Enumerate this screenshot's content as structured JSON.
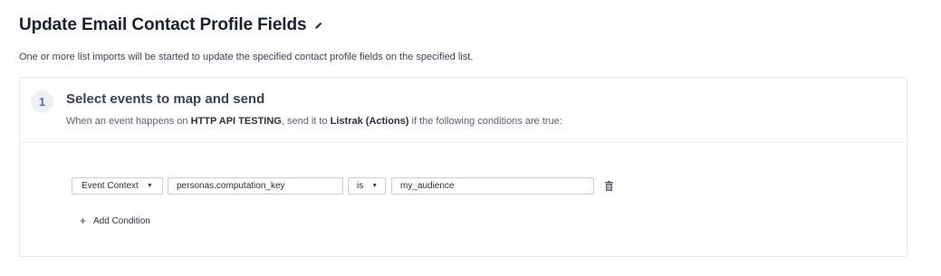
{
  "page": {
    "title": "Update Email Contact Profile Fields",
    "description": "One or more list imports will be started to update the specified contact profile fields on the specified list."
  },
  "step": {
    "number": "1",
    "title": "Select events to map and send",
    "subtitle": {
      "prefix": "When an event happens on ",
      "source": "HTTP API TESTING",
      "middle": ", send it to ",
      "destination": "Listrak (Actions)",
      "suffix": " if the following conditions are true:"
    }
  },
  "condition": {
    "field_type": "Event Context",
    "key": "personas.computation_key",
    "operator": "is",
    "value": "my_audience"
  },
  "actions": {
    "add_condition": "Add Condition"
  },
  "icons": {
    "edit": "pencil-icon",
    "delete": "trash-icon",
    "add": "plus-icon",
    "dropdown": "caret-down-icon"
  },
  "colors": {
    "accent": "#4b6cd1",
    "border": "#c9cdd6"
  }
}
